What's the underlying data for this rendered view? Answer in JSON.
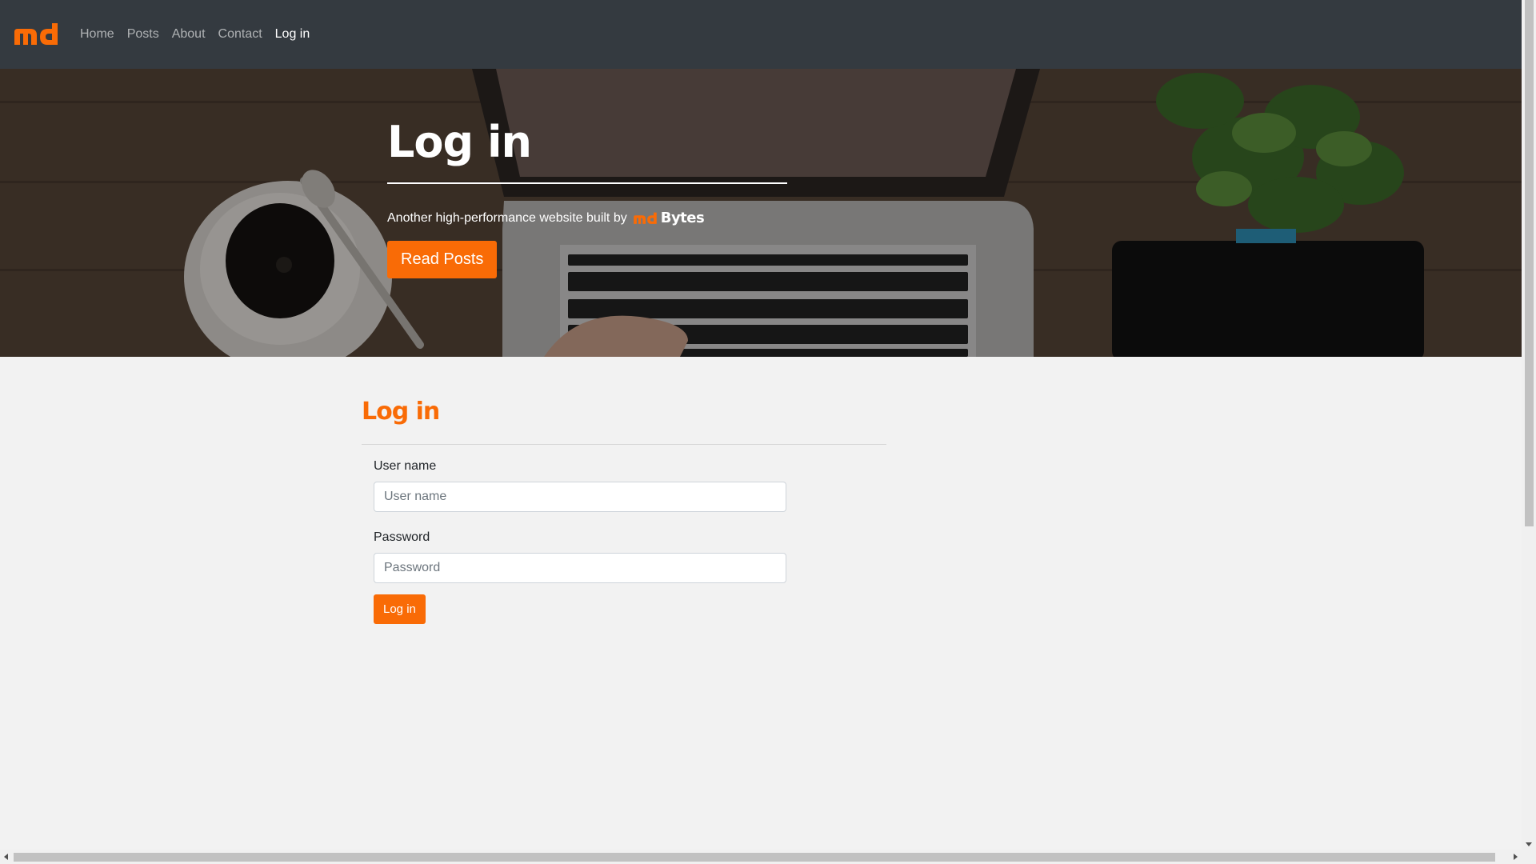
{
  "nav": {
    "brand_logo": "md-logo",
    "links": [
      {
        "label": "Home"
      },
      {
        "label": "Posts"
      },
      {
        "label": "About"
      },
      {
        "label": "Contact"
      },
      {
        "label": "Log in",
        "active": true
      }
    ]
  },
  "hero": {
    "title": "Log in",
    "subtitle": "Another high-performance website built by",
    "brand_logo": "mdBytes-logo",
    "brand_logo_text": "Bytes",
    "button_label": "Read Posts"
  },
  "login": {
    "heading": "Log in",
    "username_label": "User name",
    "username_placeholder": "User name",
    "username_value": "",
    "password_label": "Password",
    "password_placeholder": "Password",
    "password_value": "",
    "submit_label": "Log in"
  },
  "colors": {
    "accent": "#f96b06",
    "navbar": "#343a40",
    "page_background": "#f2f2f2"
  }
}
